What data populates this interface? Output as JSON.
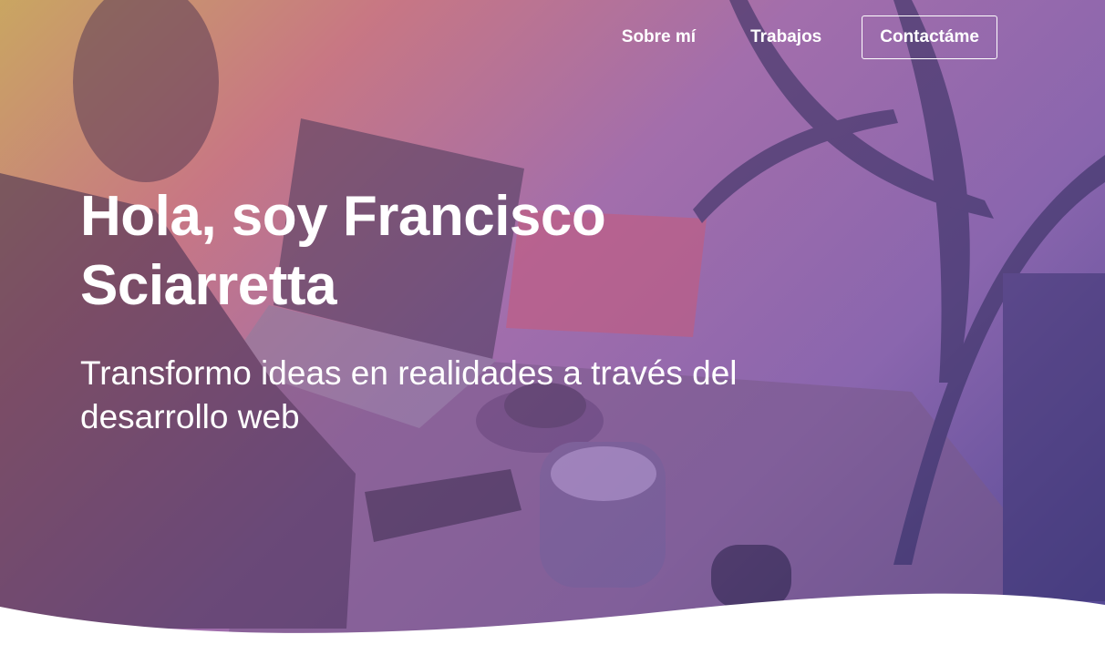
{
  "nav": {
    "about_label": "Sobre mí",
    "work_label": "Trabajos",
    "contact_label": "Contactáme"
  },
  "hero": {
    "title": "Hola, soy Francisco Sciarretta",
    "subtitle": "Transformo ideas en realidades a través del desarrollo web"
  },
  "colors": {
    "overlay_start": "#c09646",
    "overlay_mid": "#9a5aa0",
    "overlay_end": "#463c8c",
    "text": "#ffffff",
    "background": "#ffffff"
  }
}
